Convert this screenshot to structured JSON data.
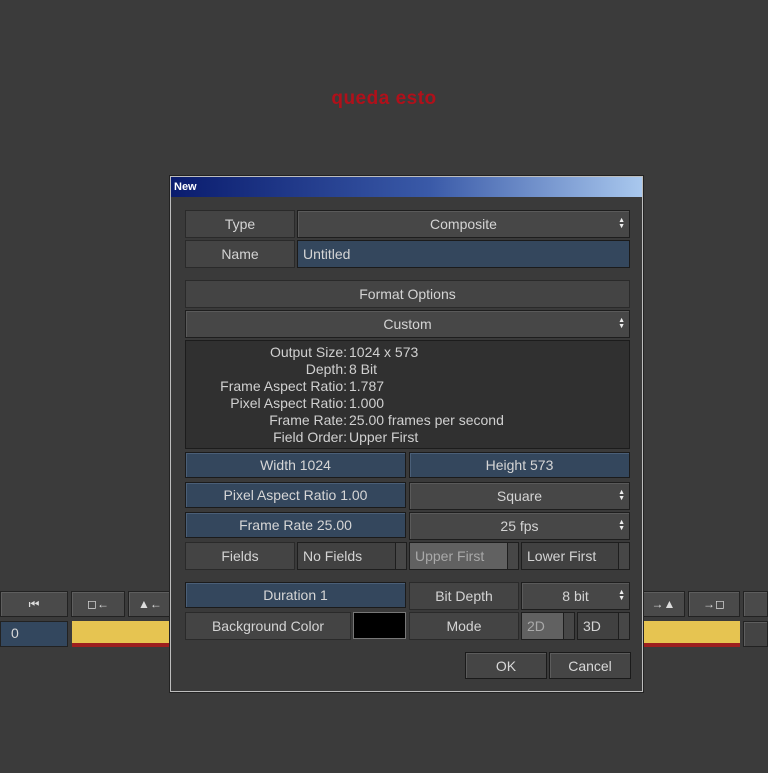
{
  "annotation": "queda esto",
  "timeline": {
    "frame_value": "0",
    "left_buttons": [
      "⏮",
      "◻←",
      "▲←"
    ],
    "right_buttons": [
      "→▲",
      "→◻"
    ],
    "yellow_color": "#e6c451"
  },
  "dialog": {
    "title": "New",
    "type_label": "Type",
    "type_value": "Composite",
    "name_label": "Name",
    "name_value": "Untitled",
    "format_options_label": "Format Options",
    "format_preset": "Custom",
    "info": [
      {
        "key": "Output Size:",
        "value": "1024 x 573"
      },
      {
        "key": "Depth:",
        "value": "8 Bit"
      },
      {
        "key": "Frame Aspect Ratio:",
        "value": "1.787"
      },
      {
        "key": "Pixel Aspect Ratio:",
        "value": "1.000"
      },
      {
        "key": "Frame Rate:",
        "value": "25.00 frames per second"
      },
      {
        "key": "Field Order:",
        "value": "Upper First"
      }
    ],
    "width_field": "Width 1024",
    "height_field": "Height 573",
    "pixel_aspect_field": "Pixel Aspect Ratio 1.00",
    "pixel_aspect_preset": "Square",
    "frame_rate_field": "Frame Rate 25.00",
    "frame_rate_preset": "25 fps",
    "fields_label": "Fields",
    "fields_options": [
      "No Fields",
      "Upper First",
      "Lower First"
    ],
    "fields_selected": "Upper First",
    "duration_field": "Duration 1",
    "bit_depth_label": "Bit Depth",
    "bit_depth_value": "8 bit",
    "background_color_label": "Background Color",
    "background_color": "#000000",
    "mode_label": "Mode",
    "mode_options": [
      "2D",
      "3D"
    ],
    "mode_selected": "2D",
    "ok_label": "OK",
    "cancel_label": "Cancel"
  }
}
